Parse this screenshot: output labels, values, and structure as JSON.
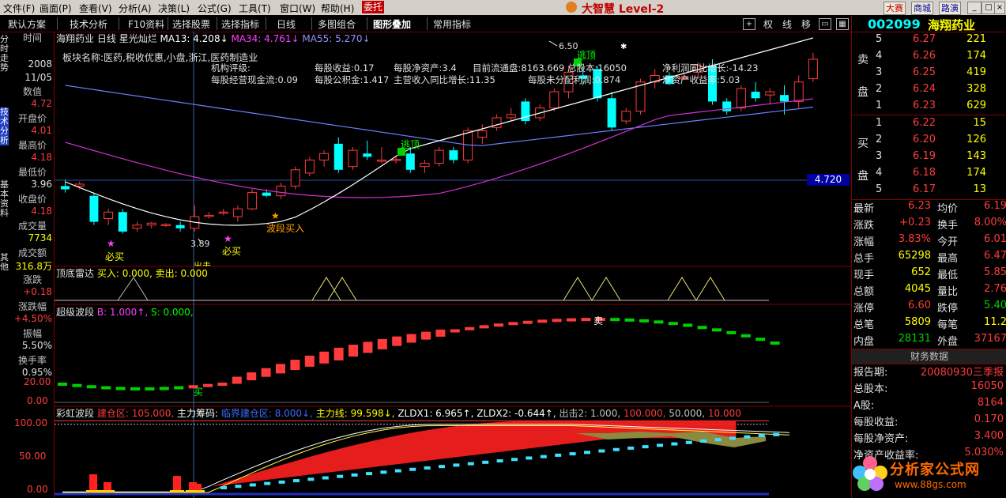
{
  "menu": {
    "items": [
      "文件(F)",
      "画面(P)",
      "查看(V)",
      "分析(A)",
      "决策(L)",
      "公式(G)",
      "工具(T)",
      "窗口(W)",
      "帮助(H)"
    ],
    "weituo": "委托",
    "brand": "大智慧 Level-2",
    "tags": [
      "大赛",
      "商城",
      "路演"
    ]
  },
  "toolbar": {
    "items": [
      "默认方案",
      "技术分析",
      "F10资料",
      "选择股票",
      "选择指标",
      "日线",
      "多图组合",
      "图形叠加",
      "常用指标"
    ],
    "right_items": [
      "权",
      "线",
      "移"
    ]
  },
  "left": {
    "vtabs": [
      "分时走势",
      "技术分析",
      "基本资料",
      "其他"
    ],
    "rows": [
      {
        "label": "时间",
        "values": [
          "2008",
          "11/05"
        ]
      },
      {
        "label": "数值",
        "values": [
          "4.72"
        ]
      },
      {
        "label": "开盘价",
        "values": [
          "4.01"
        ]
      },
      {
        "label": "最高价",
        "values": [
          "4.18"
        ]
      },
      {
        "label": "最低价",
        "values": [
          "3.96"
        ]
      },
      {
        "label": "收盘价",
        "values": [
          "4.18"
        ]
      },
      {
        "label": "成交量",
        "values": [
          "7734"
        ]
      },
      {
        "label": "成交额",
        "values": [
          "316.8万"
        ]
      },
      {
        "label": "涨跌",
        "values": [
          "+0.18"
        ]
      },
      {
        "label": "涨跌幅",
        "values": [
          "+4.50%"
        ]
      },
      {
        "label": "振幅",
        "values": [
          "5.50%"
        ]
      },
      {
        "label": "换手率",
        "values": [
          "0.95%"
        ]
      }
    ]
  },
  "main": {
    "stock_name": "海翔药业",
    "period": "日线",
    "indicator": "星光灿烂",
    "ma13": "MA13: 4.208↓",
    "ma34": "MA34: 4.761↓",
    "ma55": "MA55: 5.270↓",
    "sector": "板块名称:医药,税收优惠,小盘,浙江,医药制造业",
    "rating": "机构评级:",
    "fin": [
      "每股收益:0.17",
      "每股净资产:3.4",
      "目前流通盘:8163.669",
      "总股本:16050",
      "净利润同比增长:-14.23",
      "每股经营现金流:0.09",
      "每股公积金:1.417",
      "主营收入同比增长:11.35",
      "每股未分配利润:0.874",
      "净资产收益率:5.03"
    ],
    "price_label": "4.720",
    "high_label": "6.50",
    "low_label": "3.89",
    "annotations": [
      "逃顶",
      "逃顶",
      "必买",
      "必买",
      "波段买入",
      "出击"
    ],
    "sub1": {
      "name": "顶底雷达",
      "text": "买入: 0.000, 卖出: 0.000"
    },
    "sub2": {
      "name": "超级波段",
      "b": "B: 1.000↑,",
      "s": "S: 0.000,",
      "buy": "买",
      "sell": "卖",
      "ticks": [
        "20.00",
        "0.00"
      ]
    },
    "sub3": {
      "name": "彩虹波段",
      "parts": [
        {
          "t": "建仓区: 105.000,",
          "c": "#ff3b3b"
        },
        {
          "t": "主力筹码:",
          "c": "#ffffff"
        },
        {
          "t": "临界建仓区: 8.000↓,",
          "c": "#3a6bff"
        },
        {
          "t": "主力线: 99.598↓,",
          "c": "#ffff00"
        },
        {
          "t": "ZLDX1: 6.965↑,",
          "c": "#ffffff"
        },
        {
          "t": "ZLDX2: -0.644↑,",
          "c": "#ffffff"
        },
        {
          "t": "出击2: 1.000,",
          "c": "#c0c0c0"
        },
        {
          "t": "100.000,",
          "c": "#ff3b3b"
        },
        {
          "t": "50.000,",
          "c": "#c0c0c0"
        },
        {
          "t": "10.000",
          "c": "#ff3b3b"
        }
      ],
      "ticks": [
        "100.00",
        "50.00",
        "0.00"
      ]
    }
  },
  "right": {
    "code": "002099",
    "name": "海翔药业",
    "sell_label": [
      "卖",
      "盘"
    ],
    "buy_label": [
      "买",
      "盘"
    ],
    "asks": [
      {
        "lv": "5",
        "p": "6.27",
        "v": "221"
      },
      {
        "lv": "4",
        "p": "6.26",
        "v": "174"
      },
      {
        "lv": "3",
        "p": "6.25",
        "v": "419"
      },
      {
        "lv": "2",
        "p": "6.24",
        "v": "328"
      },
      {
        "lv": "1",
        "p": "6.23",
        "v": "629"
      }
    ],
    "bids": [
      {
        "lv": "1",
        "p": "6.22",
        "v": "15"
      },
      {
        "lv": "2",
        "p": "6.20",
        "v": "126"
      },
      {
        "lv": "3",
        "p": "6.19",
        "v": "143"
      },
      {
        "lv": "4",
        "p": "6.18",
        "v": "174"
      },
      {
        "lv": "5",
        "p": "6.17",
        "v": "13"
      }
    ],
    "stats": [
      [
        "最新",
        "6.23",
        "均价",
        "6.19"
      ],
      [
        "涨跌",
        "+0.23",
        "换手",
        "8.00%"
      ],
      [
        "涨幅",
        "3.83%",
        "今开",
        "6.01"
      ],
      [
        "总手",
        "65298",
        "最高",
        "6.47"
      ],
      [
        "现手",
        "652",
        "最低",
        "5.85"
      ],
      [
        "总额",
        "4045",
        "量比",
        "2.76"
      ],
      [
        "涨停",
        "6.60",
        "跌停",
        "5.40"
      ],
      [
        "总笔",
        "5809",
        "每笔",
        "11.2"
      ],
      [
        "内盘",
        "28131",
        "外盘",
        "37167"
      ]
    ],
    "fin_title": "财务数据",
    "fin": [
      [
        "报告期:",
        "20080930三季报"
      ],
      [
        "总股本:",
        "16050"
      ],
      [
        "A股:",
        "8164"
      ],
      [
        "每股收益:",
        "0.170"
      ],
      [
        "每股净资产:",
        "3.400"
      ],
      [
        "净资产收益率:",
        "5.030%"
      ]
    ]
  },
  "watermark": {
    "text": "分析家公式网",
    "url": "www.88gs.com"
  }
}
